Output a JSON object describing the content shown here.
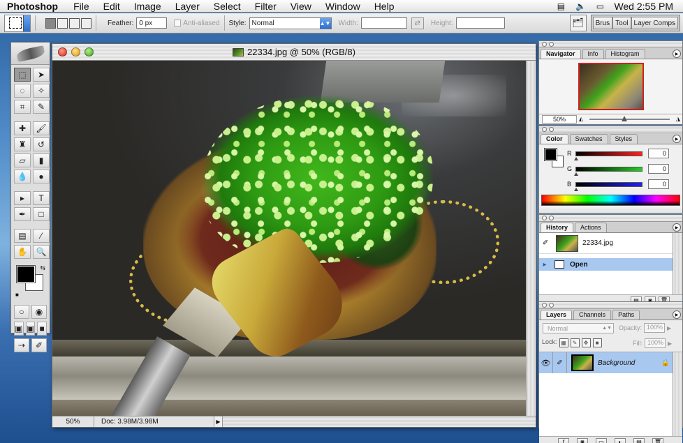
{
  "menubar": {
    "app": "Photoshop",
    "items": [
      "File",
      "Edit",
      "Image",
      "Layer",
      "Select",
      "Filter",
      "View",
      "Window",
      "Help"
    ],
    "clock": "Wed 2:55 PM",
    "icons": [
      "display-icon",
      "volume-icon",
      "battery-icon"
    ]
  },
  "options": {
    "feather_label": "Feather:",
    "feather_value": "0 px",
    "antialias_label": "Anti-aliased",
    "style_label": "Style:",
    "style_value": "Normal",
    "width_label": "Width:",
    "height_label": "Height:",
    "palette_well": [
      "Brus",
      "Tool",
      "Layer Comps"
    ]
  },
  "document": {
    "title": "22334.jpg @ 50% (RGB/8)",
    "zoom": "50%",
    "doc_info": "Doc: 3.98M/3.98M"
  },
  "navigator": {
    "tabs": [
      "Navigator",
      "Info",
      "Histogram"
    ],
    "zoom": "50%"
  },
  "color": {
    "tabs": [
      "Color",
      "Swatches",
      "Styles"
    ],
    "channels": [
      {
        "label": "R",
        "value": "0",
        "gradient": "#ff2020"
      },
      {
        "label": "G",
        "value": "0",
        "gradient": "#20d020"
      },
      {
        "label": "B",
        "value": "0",
        "gradient": "#2020ff"
      }
    ]
  },
  "history": {
    "tabs": [
      "History",
      "Actions"
    ],
    "snapshot": "22334.jpg",
    "steps": [
      "Open"
    ]
  },
  "layers": {
    "tabs": [
      "Layers",
      "Channels",
      "Paths"
    ],
    "blend_mode": "Normal",
    "opacity_label": "Opacity:",
    "opacity_value": "100%",
    "lock_label": "Lock:",
    "fill_label": "Fill:",
    "fill_value": "100%",
    "items": [
      {
        "name": "Background"
      }
    ]
  }
}
